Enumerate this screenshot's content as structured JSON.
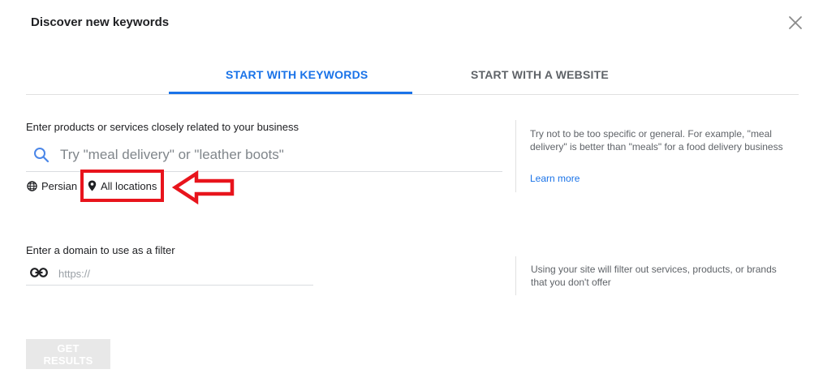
{
  "dialog": {
    "title": "Discover new keywords"
  },
  "tabs": [
    {
      "label": "START WITH KEYWORDS",
      "active": true
    },
    {
      "label": "START WITH A WEBSITE",
      "active": false
    }
  ],
  "keywords": {
    "label": "Enter products or services closely related to your business",
    "placeholder": "Try \"meal delivery\" or \"leather boots\"",
    "value": "",
    "language": "Persian",
    "location": "All locations"
  },
  "keywords_hint": {
    "text": "Try not to be too specific or general. For example, \"meal delivery\" is better than \"meals\" for a food delivery business",
    "link": "Learn more"
  },
  "domain": {
    "label": "Enter a domain to use as a filter",
    "placeholder": "https://",
    "value": ""
  },
  "domain_hint": {
    "text": "Using your site will filter out services, products, or brands that you don't offer"
  },
  "actions": {
    "submit_label": "GET RESULTS"
  },
  "colors": {
    "accent": "#1a73e8",
    "highlight": "#e8141c"
  }
}
